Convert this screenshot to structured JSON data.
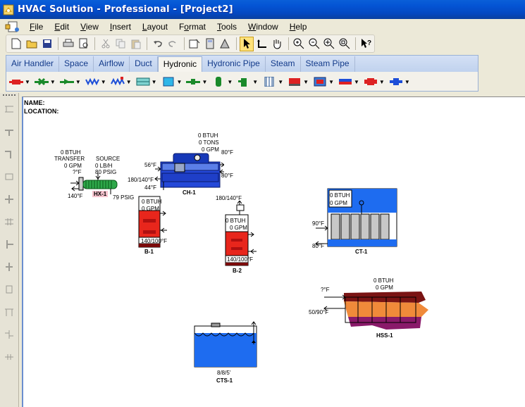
{
  "window": {
    "title": "HVAC Solution - Professional - [Project2]"
  },
  "menu": [
    {
      "label": "File",
      "u": "F",
      "rest": "ile"
    },
    {
      "label": "Edit",
      "u": "E",
      "rest": "dit"
    },
    {
      "label": "View",
      "u": "V",
      "rest": "iew"
    },
    {
      "label": "Insert",
      "u": "I",
      "rest": "nsert"
    },
    {
      "label": "Layout",
      "u": "L",
      "rest": "ayout"
    },
    {
      "label": "Format",
      "u": "o",
      "pre": "F",
      "rest": "rmat"
    },
    {
      "label": "Tools",
      "u": "T",
      "rest": "ools"
    },
    {
      "label": "Window",
      "u": "W",
      "rest": "indow"
    },
    {
      "label": "Help",
      "u": "H",
      "rest": "elp"
    }
  ],
  "tabs": [
    "Air Handler",
    "Space",
    "Airflow",
    "Duct",
    "Hydronic",
    "Hydronic Pipe",
    "Steam",
    "Steam Pipe"
  ],
  "active_tab": "Hydronic",
  "canvas": {
    "name_label": "NAME:",
    "location_label": "LOCATION:",
    "hx1": {
      "btuh": "0 BTUH",
      "transfer": "TRANSFER",
      "gpm": "0 GPM",
      "temp_in": "?°F",
      "temp_out": "140°F",
      "source": "SOURCE",
      "lbh": "0 LB/H",
      "psig": "80 PSIG",
      "psig2": "79 PSIG",
      "tag": "HX-1"
    },
    "ch1": {
      "btuh": "0 BTUH",
      "tons": "0 TONS",
      "gpm": "0 GPM",
      "t80a": "80°F",
      "t80b": "80°F",
      "t56": "56°F",
      "t180": "180/140°F",
      "t44": "44°F",
      "tag": "CH-1"
    },
    "b1": {
      "btuh": "0 BTUH",
      "gpm": "0 GPM",
      "temps": "140/100°F",
      "tag": "B-1"
    },
    "b2": {
      "top": "180/140°F",
      "btuh": "0 BTUH",
      "gpm": "0 GPM",
      "temps": "140/100°F",
      "tag": "B-2"
    },
    "ct1": {
      "btuh": "0 BTUH",
      "gpm": "0 GPM",
      "t90": "90°F",
      "t80": "80°F",
      "tag": "CT-1"
    },
    "hss1": {
      "btuh": "0 BTUH",
      "gpm": "0 GPM",
      "tin": "?°F",
      "tout": "50/90°F",
      "tag": "HSS-1"
    },
    "cts1": {
      "levels": "8/8/5'",
      "tag": "CTS-1"
    }
  },
  "colors": {
    "titlebar": "#0454d4",
    "canvas": "#ffffff",
    "boiler": "#e8261c",
    "water": "#1e6cf0",
    "chiller": "#1536c8"
  }
}
